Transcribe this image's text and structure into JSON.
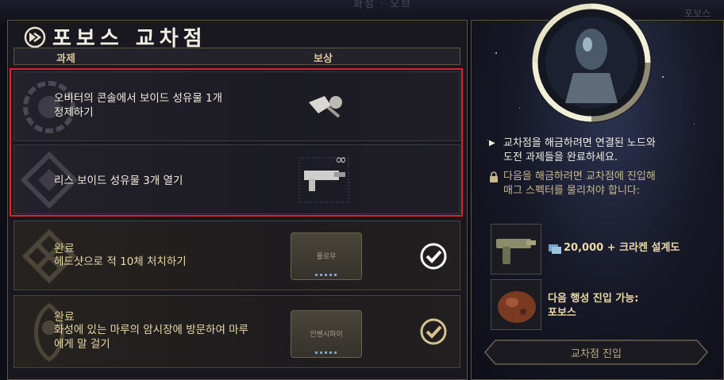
{
  "background": {
    "top_text": "화성 · 오브",
    "right_text": "포보스"
  },
  "window": {
    "title": "포보스 교차점"
  },
  "table": {
    "col_task": "과제",
    "col_reward": "보상"
  },
  "tasks": [
    {
      "status": "",
      "line1": "오비터의 콘솔에서 보이드 성유물 1개",
      "line2": "정제하기",
      "reward_label": "",
      "completed": false
    },
    {
      "status": "",
      "line1": "리스 보이드 성유물 3개 열기",
      "line2": "",
      "reward_label": "∞",
      "completed": false
    },
    {
      "status": "완료",
      "line1": "헤드샷으로 적 10체 처치하기",
      "line2": "",
      "reward_label": "플로우",
      "completed": true
    },
    {
      "status": "완료",
      "line1": "화성에 있는 마루의 암시장에 방문하여 마루",
      "line2": "에게 말 걸기",
      "reward_label": "인벤시파이",
      "completed": true
    }
  ],
  "info": {
    "line1": "교차점을 해금하려면 연결된 노드와",
    "line2": "도전 과제들을 완료하세요.",
    "lock1": "다음을 해금하려면 교차점에 진입해",
    "lock2": "매그 스펙터를 물리쳐야 합니다:"
  },
  "rewards": {
    "weapon_text": "20,000 + 크라켄 설계도",
    "planet_line1": "다음 행성 진입 가능:",
    "planet_line2": "포보스"
  },
  "enter_button": {
    "label": "교차점 진입"
  },
  "colors": {
    "accent_gold": "#d9c79a",
    "highlight_red": "#e0202a",
    "check_white": "#ffffff",
    "check_gold": "#d4c38e"
  }
}
